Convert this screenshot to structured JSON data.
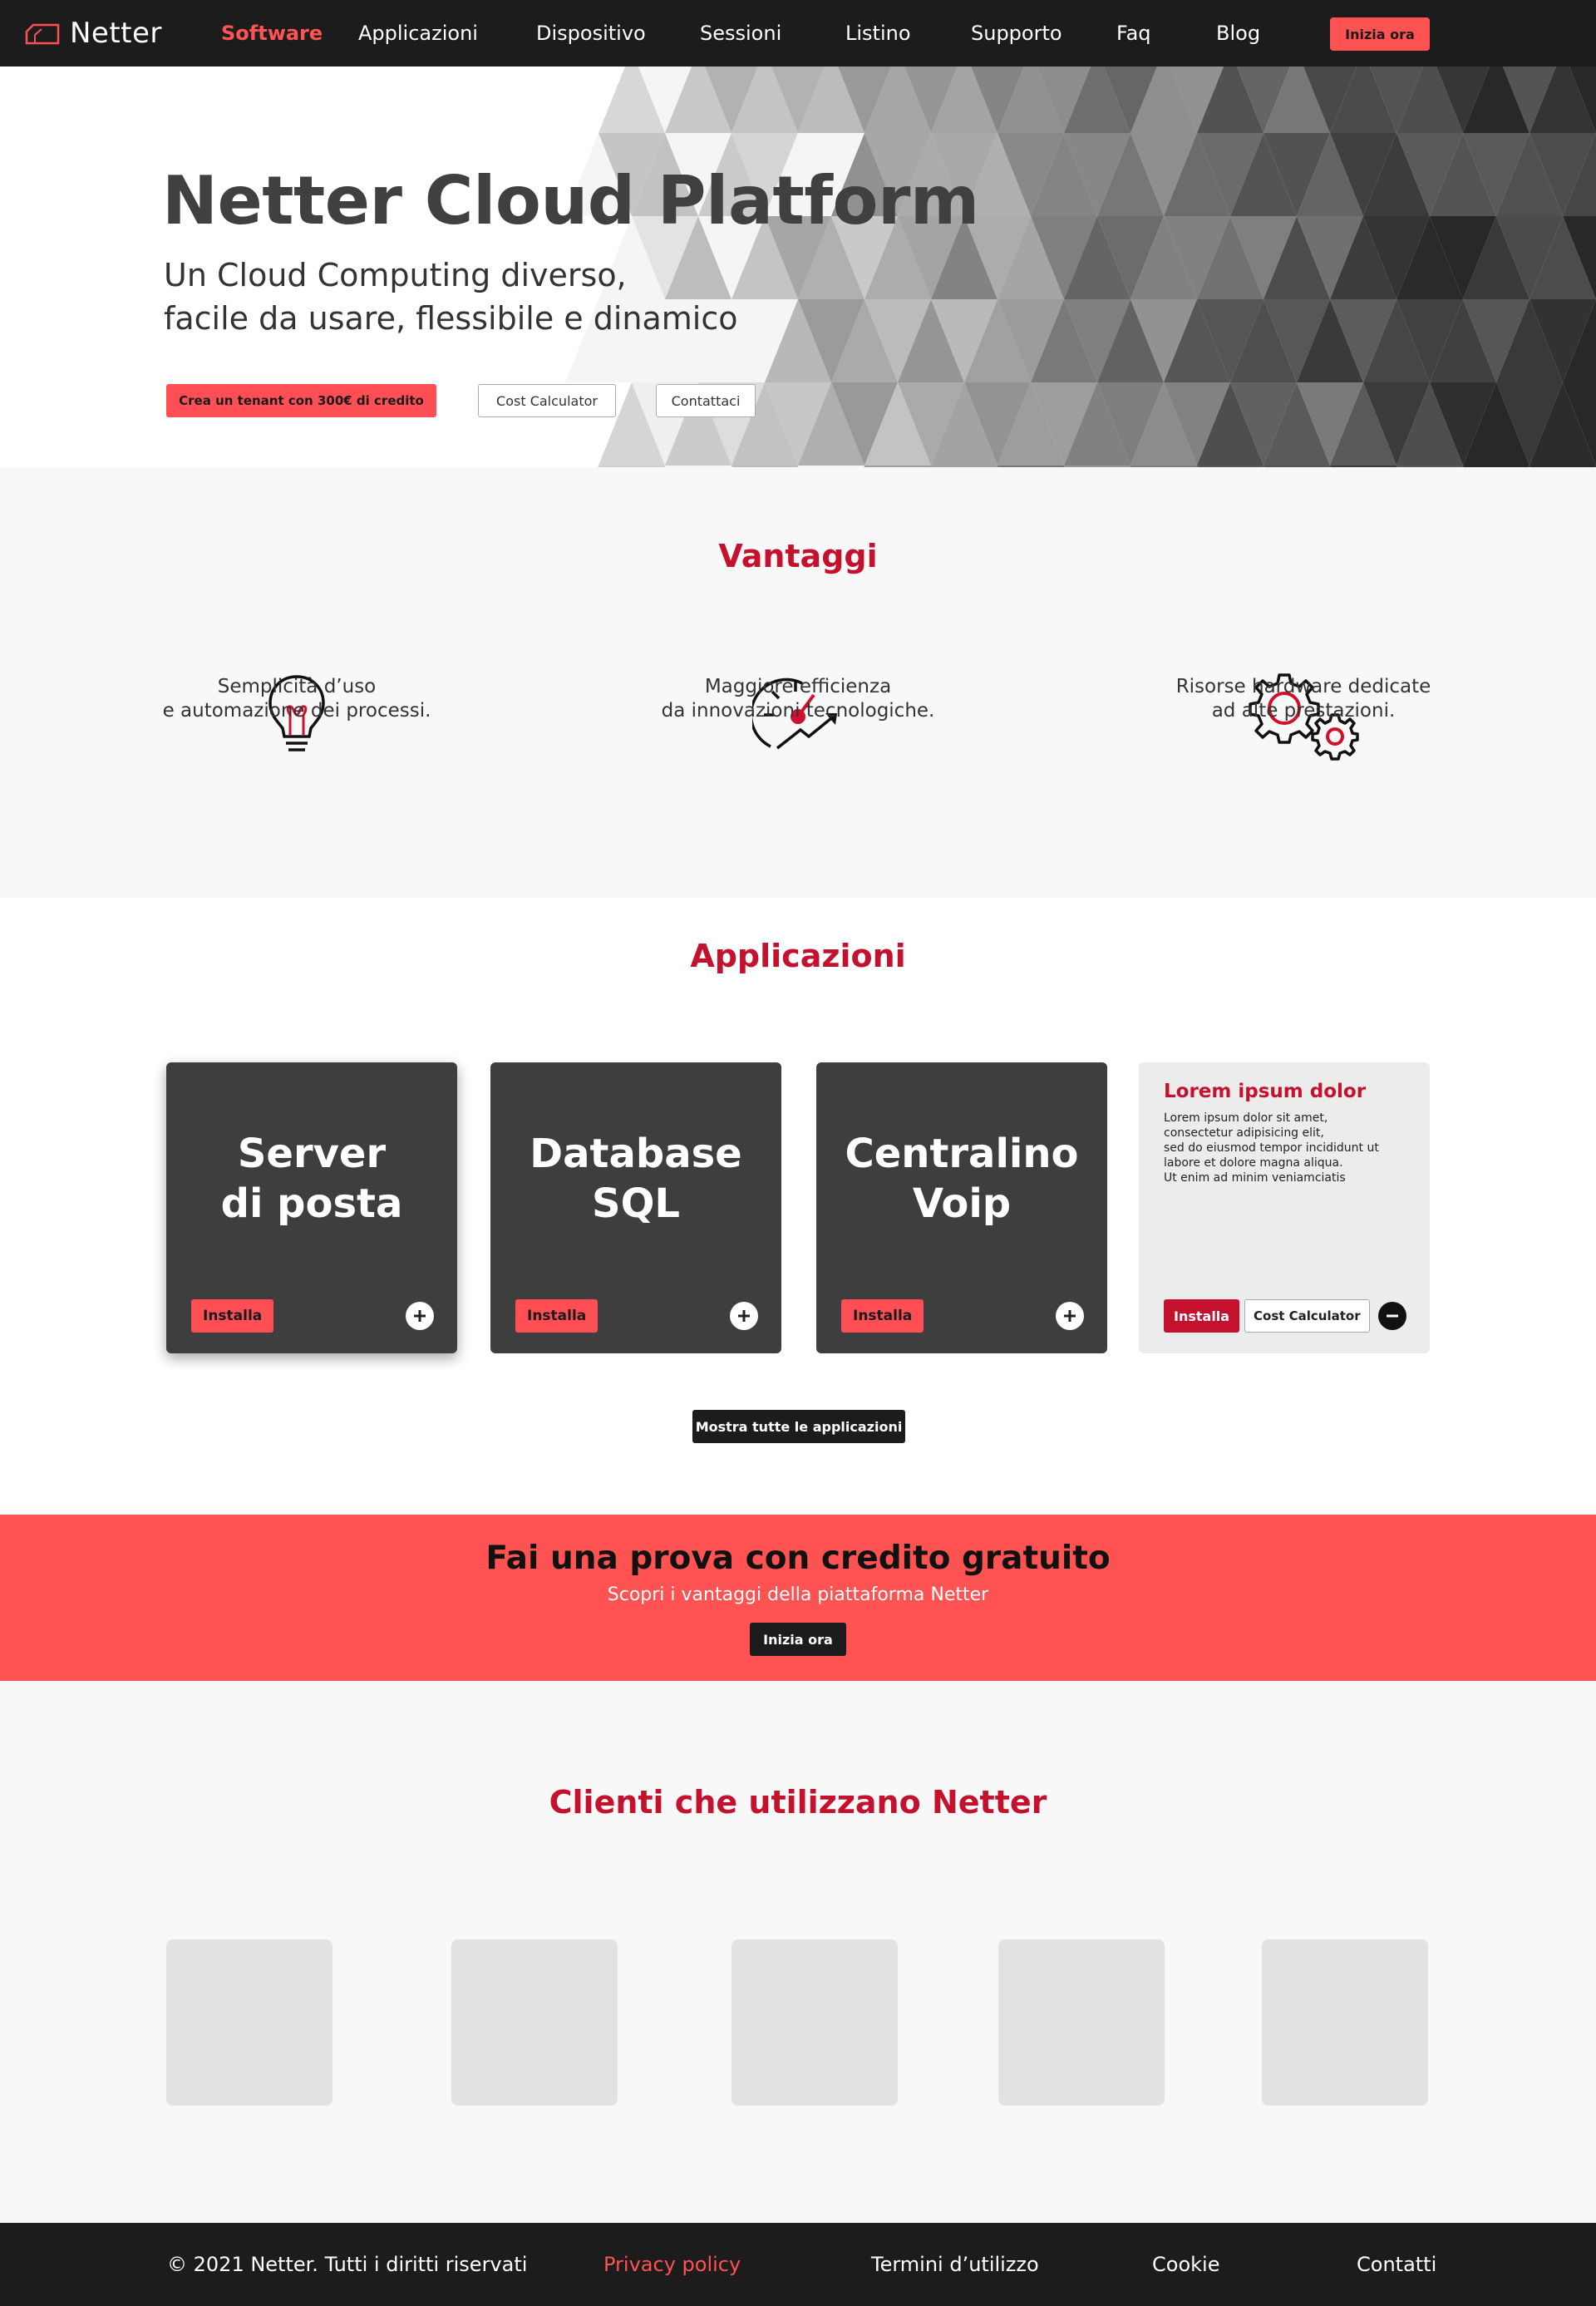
{
  "brand": {
    "name": "Netter",
    "accent": "#ff5252",
    "title_color": "#c3112e",
    "dark": "#1c1c1c"
  },
  "nav": {
    "items": [
      "Software",
      "Applicazioni",
      "Dispositivo",
      "Sessioni",
      "Listino",
      "Supporto",
      "Faq",
      "Blog"
    ],
    "active": "Software",
    "cta": "Inizia ora"
  },
  "hero": {
    "title": "Netter Cloud Platform",
    "subtitle_line1": "Un Cloud Computing diverso,",
    "subtitle_line2": "facile da usare, flessibile e dinamico",
    "btn_primary": "Crea un tenant con 300€ di credito",
    "btn_calc": "Cost Calculator",
    "btn_contact": "Contattaci"
  },
  "vantaggi": {
    "title": "Vantaggi",
    "items": [
      {
        "icon": "lightbulb-icon",
        "line1": "Semplicità d’uso",
        "line2": "e automazione dei processi."
      },
      {
        "icon": "speedometer-icon",
        "line1": "Maggiore efficienza",
        "line2": "da innovazioni tecnologiche."
      },
      {
        "icon": "gears-icon",
        "line1": "Risorse hardware dedicate",
        "line2": "ad alte prestazioni."
      }
    ]
  },
  "applicazioni": {
    "title": "Applicazioni",
    "cards": [
      {
        "title_line1": "Server",
        "title_line2": "di posta",
        "install": "Installa"
      },
      {
        "title_line1": "Database",
        "title_line2": "SQL",
        "install": "Installa"
      },
      {
        "title_line1": "Centralino",
        "title_line2": "Voip",
        "install": "Installa"
      }
    ],
    "expanded_card": {
      "title": "Lorem ipsum dolor",
      "body": "Lorem ipsum dolor sit amet,\nconsectetur adipisicing elit,\nsed do eiusmod tempor incididunt ut\nlabore et dolore magna aliqua.\nUt enim ad minim veniamciatis",
      "install": "Installa",
      "calc": "Cost Calculator"
    },
    "show_all": "Mostra tutte le applicazioni"
  },
  "promo": {
    "title": "Fai una prova con credito gratuito",
    "subtitle": "Scopri i vantaggi della piattaforma Netter",
    "cta": "Inizia ora"
  },
  "clienti": {
    "title": "Clienti che utilizzano Netter"
  },
  "footer": {
    "copyright": "© 2021 Netter. Tutti i diritti riservati",
    "privacy": "Privacy policy",
    "terms": "Termini d’utilizzo",
    "cookie": "Cookie",
    "contacts": "Contatti"
  }
}
